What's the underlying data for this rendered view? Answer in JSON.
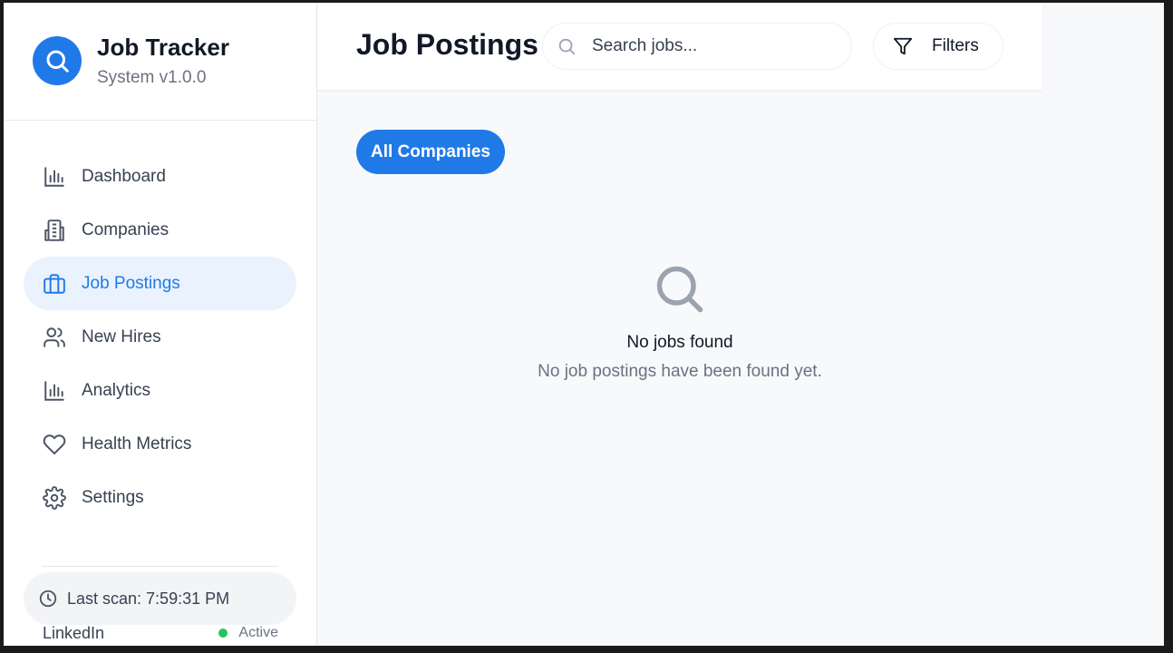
{
  "brand": {
    "title": "Job Tracker",
    "subtitle": "System v1.0.0",
    "icon": "search-icon",
    "color": "#1f7ae8"
  },
  "nav": {
    "items": [
      {
        "label": "Dashboard",
        "icon": "bar-chart-icon",
        "active": false
      },
      {
        "label": "Companies",
        "icon": "building-icon",
        "active": false
      },
      {
        "label": "Job Postings",
        "icon": "briefcase-icon",
        "active": true
      },
      {
        "label": "New Hires",
        "icon": "users-icon",
        "active": false
      },
      {
        "label": "Analytics",
        "icon": "bar-chart-icon",
        "active": false
      },
      {
        "label": "Health Metrics",
        "icon": "heart-icon",
        "active": false
      },
      {
        "label": "Settings",
        "icon": "gear-icon",
        "active": false
      }
    ]
  },
  "status": {
    "last_scan": "Last scan: 7:59:31 PM",
    "source_name": "LinkedIn",
    "source_status": "Active",
    "status_color": "#22c55e"
  },
  "header": {
    "title": "Job Postings",
    "search_placeholder": "Search jobs...",
    "filters_label": "Filters"
  },
  "filter_chip": {
    "label": "All Companies"
  },
  "empty_state": {
    "title": "No jobs found",
    "description": "No job postings have been found yet."
  }
}
